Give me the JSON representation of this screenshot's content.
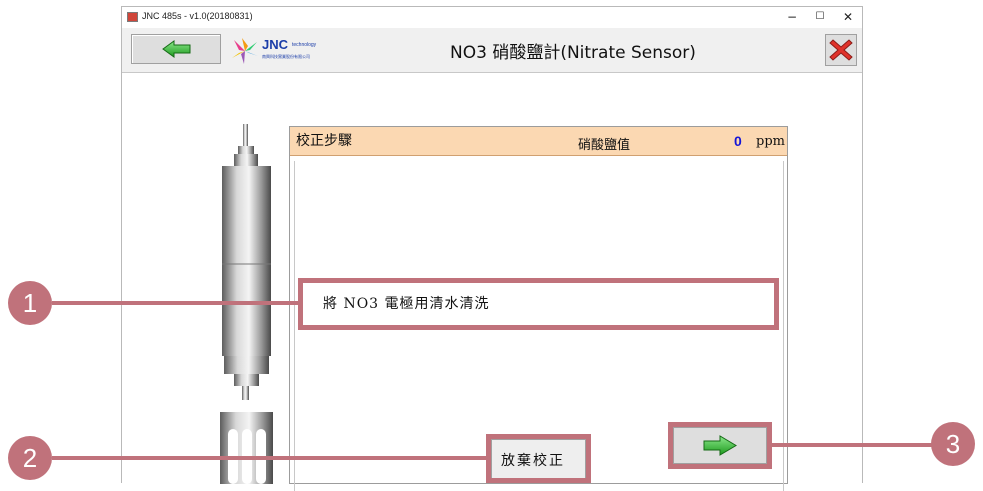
{
  "window": {
    "app_title": "JNC 485s - v1.0(20180831)",
    "minimize": "−",
    "maximize": "☐",
    "close": "✕"
  },
  "toolbar": {
    "back_icon": "green-left-arrow-icon",
    "logo_text": "JNC",
    "logo_tech": "technology",
    "logo_sub": "南興科技實業股份有限公司",
    "title": "NO3 硝酸鹽計(Nitrate Sensor)",
    "exit_icon": "red-x-icon"
  },
  "panel": {
    "title": "校正步驟",
    "reading_label": "硝酸鹽值",
    "reading_value": "0",
    "reading_unit": "ppm",
    "step_text": "將 NO3 電極用清水清洗"
  },
  "buttons": {
    "give_up_label": "放棄校正",
    "next_icon": "green-right-arrow-icon"
  },
  "callouts": [
    "1",
    "2",
    "3"
  ],
  "colors": {
    "header_bg": "#fbd8b2",
    "reading_value": "#1515d6",
    "annotation": "#c0727b",
    "arrow_green": "#2fb52f",
    "close_red": "#e0322a"
  }
}
